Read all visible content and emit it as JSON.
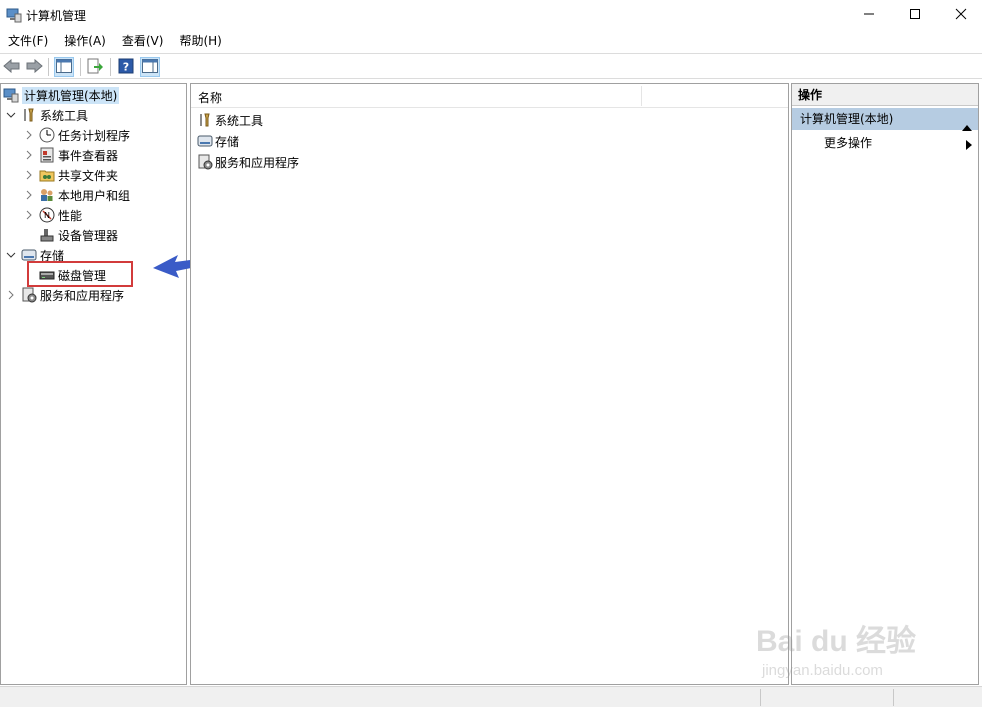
{
  "window": {
    "title": "计算机管理",
    "controls": {
      "minimize_icon": "minimize-icon",
      "maximize_icon": "maximize-icon",
      "close_icon": "close-icon"
    }
  },
  "menu": [
    "文件(F)",
    "操作(A)",
    "查看(V)",
    "帮助(H)"
  ],
  "toolbar": {
    "buttons": [
      "back-icon",
      "forward-icon",
      "show-hide-tree-icon",
      "export-list-icon",
      "help-icon",
      "show-hide-action-pane-icon"
    ]
  },
  "tree": {
    "root": "计算机管理(本地)",
    "items": [
      {
        "label": "系统工具",
        "level": 1,
        "state": "expanded",
        "icon": "tools-icon"
      },
      {
        "label": "任务计划程序",
        "level": 2,
        "state": "collapsed",
        "icon": "clock-icon"
      },
      {
        "label": "事件查看器",
        "level": 2,
        "state": "collapsed",
        "icon": "event-viewer-icon"
      },
      {
        "label": "共享文件夹",
        "level": 2,
        "state": "collapsed",
        "icon": "shared-folder-icon"
      },
      {
        "label": "本地用户和组",
        "level": 2,
        "state": "collapsed",
        "icon": "users-icon"
      },
      {
        "label": "性能",
        "level": 2,
        "state": "collapsed",
        "icon": "performance-icon"
      },
      {
        "label": "设备管理器",
        "level": 2,
        "state": "leaf",
        "icon": "device-manager-icon"
      },
      {
        "label": "存储",
        "level": 1,
        "state": "expanded",
        "icon": "storage-icon"
      },
      {
        "label": "磁盘管理",
        "level": 2,
        "state": "leaf",
        "icon": "disk-icon"
      },
      {
        "label": "服务和应用程序",
        "level": 1,
        "state": "collapsed",
        "icon": "services-icon"
      }
    ]
  },
  "list": {
    "column_header": "名称",
    "rows": [
      {
        "label": "系统工具",
        "icon": "tools-icon"
      },
      {
        "label": "存储",
        "icon": "storage-icon"
      },
      {
        "label": "服务和应用程序",
        "icon": "services-icon"
      }
    ]
  },
  "actions": {
    "header": "操作",
    "section": "计算机管理(本地)",
    "more": "更多操作"
  },
  "watermark": {
    "line1": "Bai du 经验",
    "line2": "jingyan.baidu.com"
  },
  "colors": {
    "selection": "#cce4f7",
    "action_section": "#b6cce2",
    "highlight_border": "#d23b3b",
    "arrow": "#3a5bc7"
  }
}
